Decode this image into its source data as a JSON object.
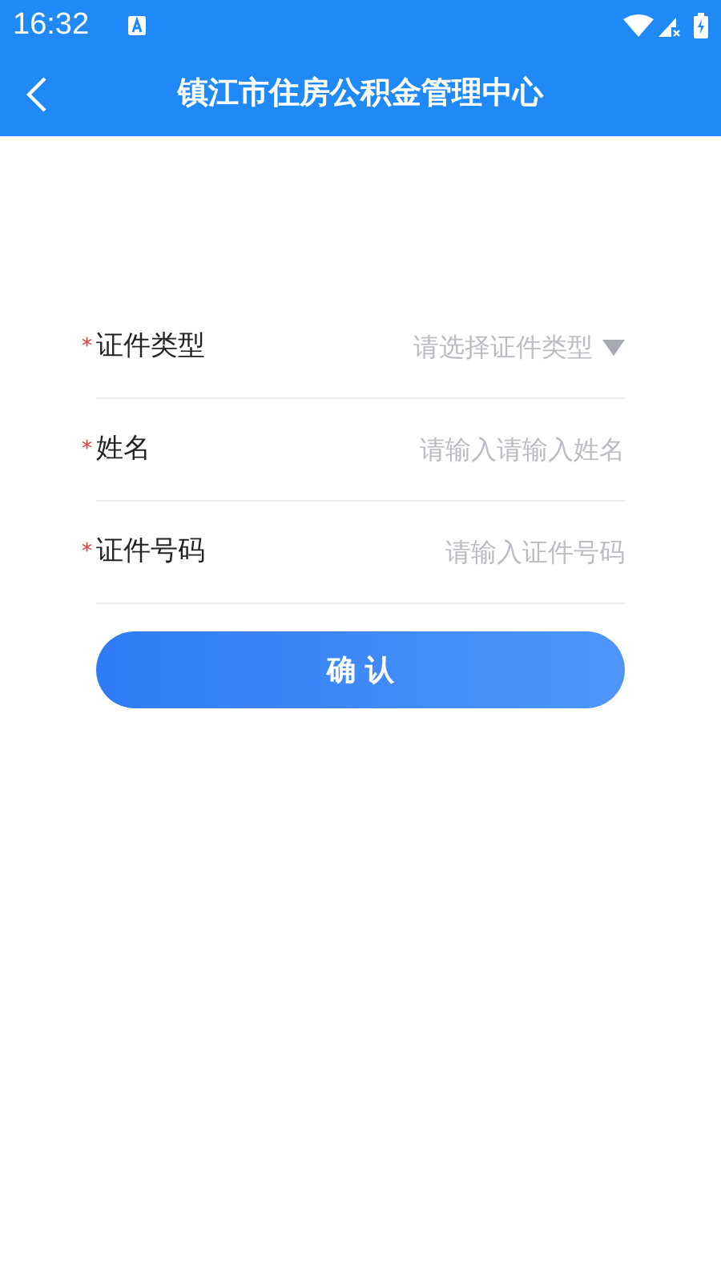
{
  "status_bar": {
    "time": "16:32"
  },
  "header": {
    "title": "镇江市住房公积金管理中心"
  },
  "form": {
    "fields": [
      {
        "kind": "select",
        "mark": "*",
        "label": "证件类型",
        "placeholder": "请选择证件类型"
      },
      {
        "kind": "input",
        "mark": "*",
        "label": "姓名",
        "placeholder": "请输入请输入姓名"
      },
      {
        "kind": "input",
        "mark": "*",
        "label": "证件号码",
        "placeholder": "请输入证件号码"
      }
    ],
    "submit": "确 认"
  }
}
